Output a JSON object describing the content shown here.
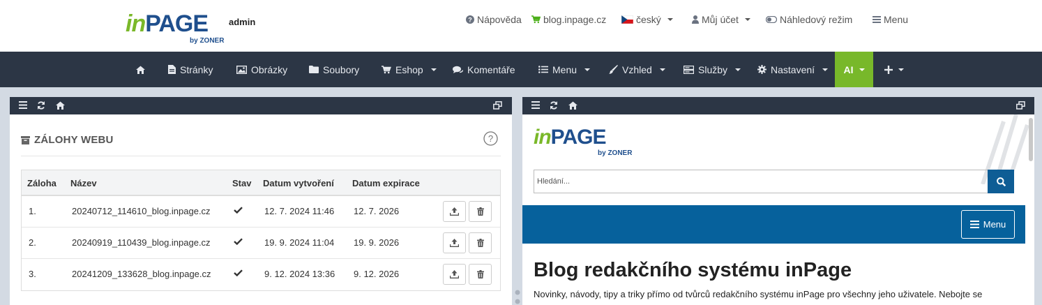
{
  "header": {
    "logo": {
      "in": "in",
      "page": "PAGE",
      "admin": "admin",
      "by": "by ZONER"
    },
    "links": {
      "help": "Nápověda",
      "blog": "blog.inpage.cz",
      "language": "český",
      "account": "Můj účet",
      "preview": "Náhledový režim",
      "menu": "Menu"
    }
  },
  "nav": {
    "items": [
      {
        "label": "Stránky"
      },
      {
        "label": "Obrázky"
      },
      {
        "label": "Soubory"
      },
      {
        "label": "Eshop"
      },
      {
        "label": "Komentáře"
      },
      {
        "label": "Menu"
      },
      {
        "label": "Vzhled"
      },
      {
        "label": "Služby"
      },
      {
        "label": "Nastavení"
      },
      {
        "label": "AI"
      }
    ]
  },
  "backups": {
    "title": "ZÁLOHY WEBU",
    "columns": [
      "Záloha",
      "Název",
      "Stav",
      "Datum vytvoření",
      "Datum expirace"
    ],
    "rows": [
      {
        "num": "1.",
        "name": "20240712_114610_blog.inpage.cz",
        "created": "12. 7. 2024 11:46",
        "expires": "12. 7. 2026"
      },
      {
        "num": "2.",
        "name": "20240919_110439_blog.inpage.cz",
        "created": "19. 9. 2024 11:04",
        "expires": "19. 9. 2026"
      },
      {
        "num": "3.",
        "name": "20241209_133628_blog.inpage.cz",
        "created": "9. 12. 2024 13:36",
        "expires": "9. 12. 2026"
      }
    ]
  },
  "preview": {
    "logo": {
      "in": "in",
      "page": "PAGE",
      "by": "by ZONER"
    },
    "search_placeholder": "Hledání...",
    "menu_label": "Menu",
    "title": "Blog redakčního systému inPage",
    "description": "Novinky, návody, tipy a triky přímo od tvůrců redakčního systému inPage pro všechny jeho uživatele. Nebojte se"
  },
  "colors": {
    "navbar": "#2c3645",
    "ai_accent": "#78b82a",
    "brand_blue": "#1f4f8d",
    "preview_band": "#06619c"
  }
}
